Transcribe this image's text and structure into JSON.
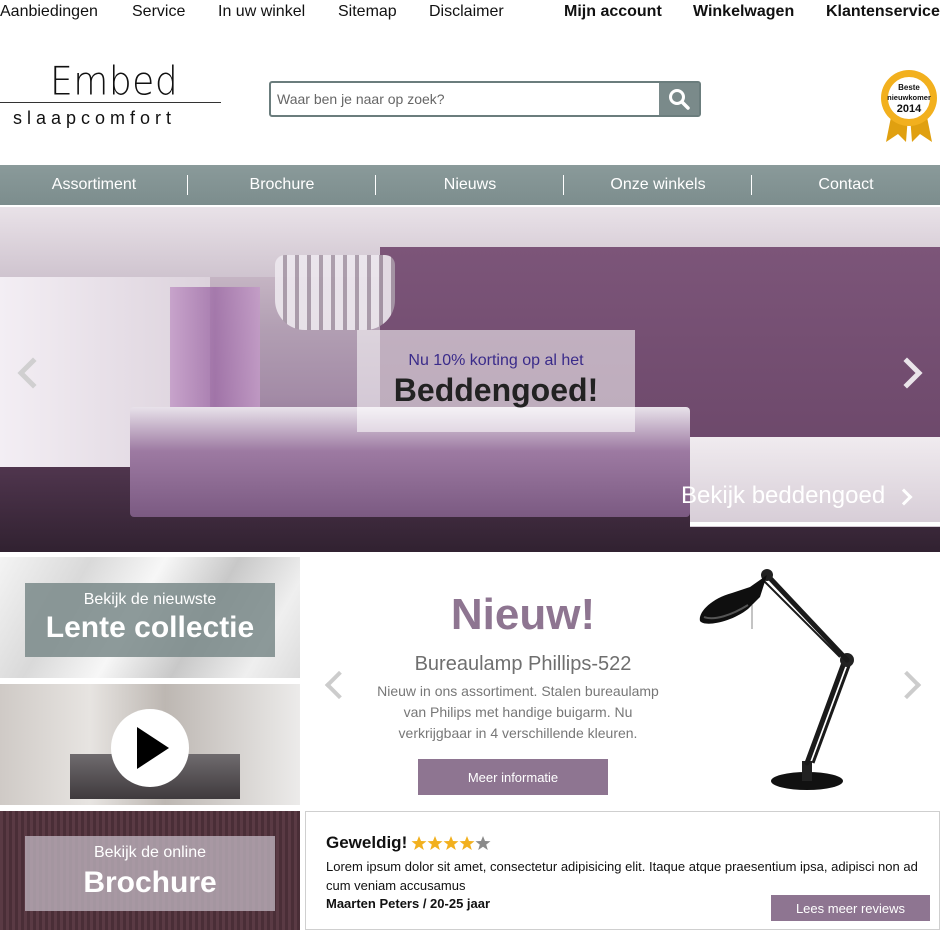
{
  "top_links_left": [
    "Aanbiedingen",
    "Service",
    "In uw winkel",
    "Sitemap",
    "Disclaimer"
  ],
  "top_links_right": [
    "Mijn account",
    "Winkelwagen",
    "Klantenservice"
  ],
  "logo": {
    "name": "Embed",
    "tagline": "slaapcomfort"
  },
  "search": {
    "placeholder": "Waar ben je naar op zoek?",
    "icon": "search-icon"
  },
  "award": {
    "line1": "Beste",
    "line2": "nieuwkomer",
    "year": "2014"
  },
  "nav": [
    "Assortiment",
    "Brochure",
    "Nieuws",
    "Onze winkels",
    "Contact"
  ],
  "hero": {
    "promo_line1": "Nu 10% korting op al het",
    "promo_line2": "Beddengoed!",
    "cta": "Bekijk beddengoed"
  },
  "tiles": {
    "collection_small": "Bekijk de nieuwste",
    "collection_big": "Lente collectie",
    "brochure_small": "Bekijk de online",
    "brochure_big": "Brochure"
  },
  "product": {
    "title": "Nieuw!",
    "name": "Bureaulamp Phillips-522",
    "description": "Nieuw in ons assortiment. Stalen bureaulamp van Philips met handige buigarm. Nu verkrijgbaar in 4 verschillende kleuren.",
    "button": "Meer informatie"
  },
  "review": {
    "heading": "Geweldig!",
    "rating": 4,
    "max_rating": 5,
    "text": "Lorem ipsum dolor sit amet, consectetur adipisicing elit. Itaque atque praesentium ipsa, adipisci non ad cum veniam accusamus",
    "author": "Maarten Peters / 20-25 jaar",
    "button": "Lees meer reviews"
  },
  "colors": {
    "accent": "#8e7591",
    "nav": "#7c8d8d",
    "gold": "#f2b01e"
  }
}
